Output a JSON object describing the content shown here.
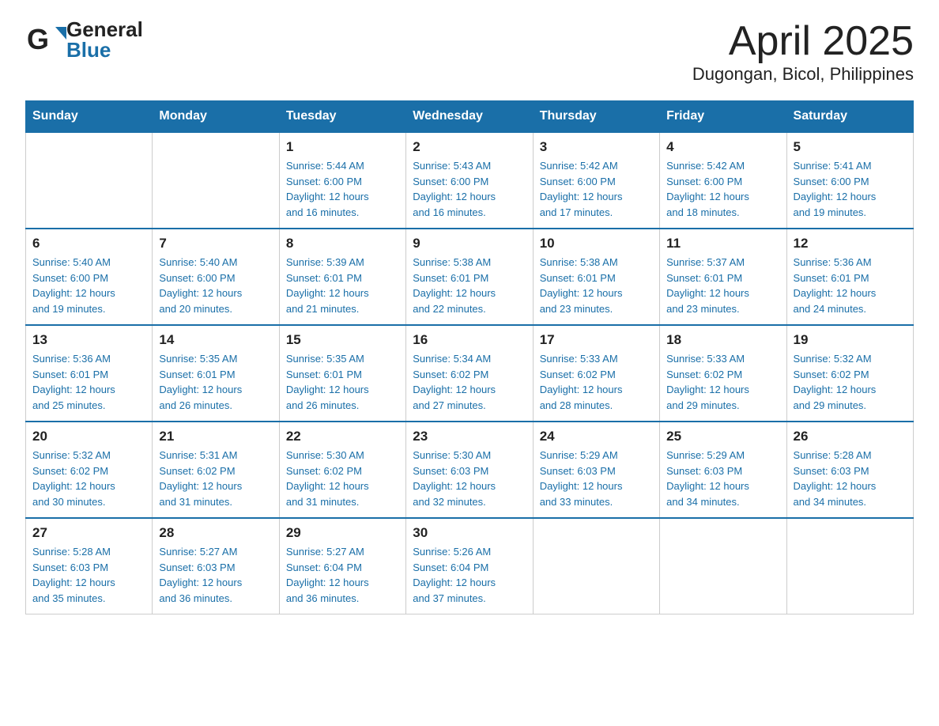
{
  "header": {
    "logo_general": "General",
    "logo_blue": "Blue",
    "title": "April 2025",
    "subtitle": "Dugongan, Bicol, Philippines"
  },
  "days_of_week": [
    "Sunday",
    "Monday",
    "Tuesday",
    "Wednesday",
    "Thursday",
    "Friday",
    "Saturday"
  ],
  "weeks": [
    [
      {
        "day": "",
        "info": ""
      },
      {
        "day": "",
        "info": ""
      },
      {
        "day": "1",
        "info": "Sunrise: 5:44 AM\nSunset: 6:00 PM\nDaylight: 12 hours\nand 16 minutes."
      },
      {
        "day": "2",
        "info": "Sunrise: 5:43 AM\nSunset: 6:00 PM\nDaylight: 12 hours\nand 16 minutes."
      },
      {
        "day": "3",
        "info": "Sunrise: 5:42 AM\nSunset: 6:00 PM\nDaylight: 12 hours\nand 17 minutes."
      },
      {
        "day": "4",
        "info": "Sunrise: 5:42 AM\nSunset: 6:00 PM\nDaylight: 12 hours\nand 18 minutes."
      },
      {
        "day": "5",
        "info": "Sunrise: 5:41 AM\nSunset: 6:00 PM\nDaylight: 12 hours\nand 19 minutes."
      }
    ],
    [
      {
        "day": "6",
        "info": "Sunrise: 5:40 AM\nSunset: 6:00 PM\nDaylight: 12 hours\nand 19 minutes."
      },
      {
        "day": "7",
        "info": "Sunrise: 5:40 AM\nSunset: 6:00 PM\nDaylight: 12 hours\nand 20 minutes."
      },
      {
        "day": "8",
        "info": "Sunrise: 5:39 AM\nSunset: 6:01 PM\nDaylight: 12 hours\nand 21 minutes."
      },
      {
        "day": "9",
        "info": "Sunrise: 5:38 AM\nSunset: 6:01 PM\nDaylight: 12 hours\nand 22 minutes."
      },
      {
        "day": "10",
        "info": "Sunrise: 5:38 AM\nSunset: 6:01 PM\nDaylight: 12 hours\nand 23 minutes."
      },
      {
        "day": "11",
        "info": "Sunrise: 5:37 AM\nSunset: 6:01 PM\nDaylight: 12 hours\nand 23 minutes."
      },
      {
        "day": "12",
        "info": "Sunrise: 5:36 AM\nSunset: 6:01 PM\nDaylight: 12 hours\nand 24 minutes."
      }
    ],
    [
      {
        "day": "13",
        "info": "Sunrise: 5:36 AM\nSunset: 6:01 PM\nDaylight: 12 hours\nand 25 minutes."
      },
      {
        "day": "14",
        "info": "Sunrise: 5:35 AM\nSunset: 6:01 PM\nDaylight: 12 hours\nand 26 minutes."
      },
      {
        "day": "15",
        "info": "Sunrise: 5:35 AM\nSunset: 6:01 PM\nDaylight: 12 hours\nand 26 minutes."
      },
      {
        "day": "16",
        "info": "Sunrise: 5:34 AM\nSunset: 6:02 PM\nDaylight: 12 hours\nand 27 minutes."
      },
      {
        "day": "17",
        "info": "Sunrise: 5:33 AM\nSunset: 6:02 PM\nDaylight: 12 hours\nand 28 minutes."
      },
      {
        "day": "18",
        "info": "Sunrise: 5:33 AM\nSunset: 6:02 PM\nDaylight: 12 hours\nand 29 minutes."
      },
      {
        "day": "19",
        "info": "Sunrise: 5:32 AM\nSunset: 6:02 PM\nDaylight: 12 hours\nand 29 minutes."
      }
    ],
    [
      {
        "day": "20",
        "info": "Sunrise: 5:32 AM\nSunset: 6:02 PM\nDaylight: 12 hours\nand 30 minutes."
      },
      {
        "day": "21",
        "info": "Sunrise: 5:31 AM\nSunset: 6:02 PM\nDaylight: 12 hours\nand 31 minutes."
      },
      {
        "day": "22",
        "info": "Sunrise: 5:30 AM\nSunset: 6:02 PM\nDaylight: 12 hours\nand 31 minutes."
      },
      {
        "day": "23",
        "info": "Sunrise: 5:30 AM\nSunset: 6:03 PM\nDaylight: 12 hours\nand 32 minutes."
      },
      {
        "day": "24",
        "info": "Sunrise: 5:29 AM\nSunset: 6:03 PM\nDaylight: 12 hours\nand 33 minutes."
      },
      {
        "day": "25",
        "info": "Sunrise: 5:29 AM\nSunset: 6:03 PM\nDaylight: 12 hours\nand 34 minutes."
      },
      {
        "day": "26",
        "info": "Sunrise: 5:28 AM\nSunset: 6:03 PM\nDaylight: 12 hours\nand 34 minutes."
      }
    ],
    [
      {
        "day": "27",
        "info": "Sunrise: 5:28 AM\nSunset: 6:03 PM\nDaylight: 12 hours\nand 35 minutes."
      },
      {
        "day": "28",
        "info": "Sunrise: 5:27 AM\nSunset: 6:03 PM\nDaylight: 12 hours\nand 36 minutes."
      },
      {
        "day": "29",
        "info": "Sunrise: 5:27 AM\nSunset: 6:04 PM\nDaylight: 12 hours\nand 36 minutes."
      },
      {
        "day": "30",
        "info": "Sunrise: 5:26 AM\nSunset: 6:04 PM\nDaylight: 12 hours\nand 37 minutes."
      },
      {
        "day": "",
        "info": ""
      },
      {
        "day": "",
        "info": ""
      },
      {
        "day": "",
        "info": ""
      }
    ]
  ]
}
